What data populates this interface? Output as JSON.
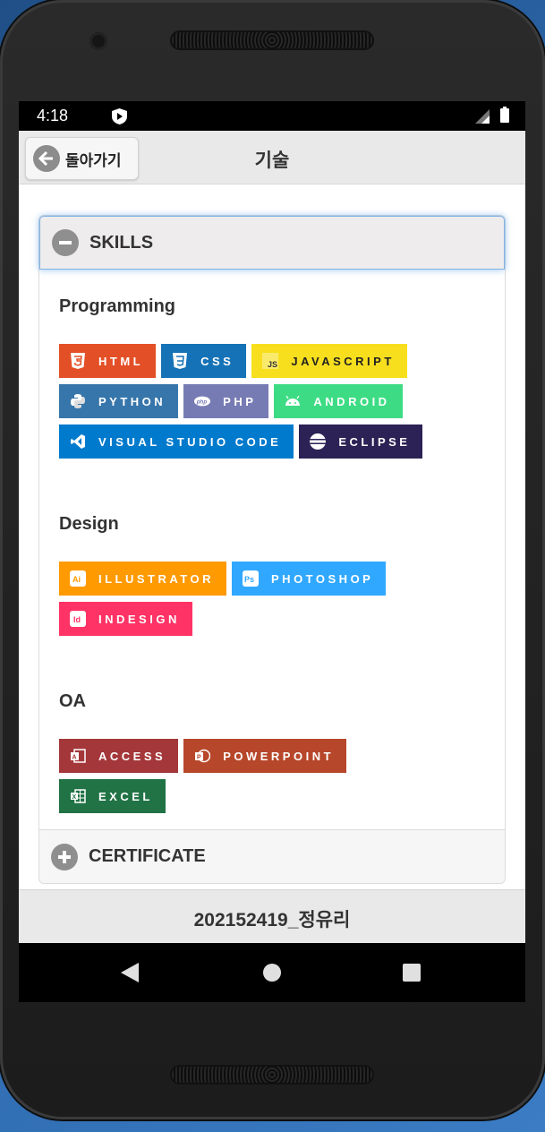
{
  "status": {
    "time": "4:18"
  },
  "topbar": {
    "back_label": "돌아가기",
    "title": "기술"
  },
  "skills": {
    "header": "SKILLS",
    "sections": [
      {
        "title": "Programming",
        "badges": [
          {
            "label": "HTML",
            "color": "#e34f26",
            "icon": "html5-icon"
          },
          {
            "label": "CSS",
            "color": "#1572b6",
            "icon": "css3-icon"
          },
          {
            "label": "JAVASCRIPT",
            "color": "#f7df1e",
            "icon": "javascript-icon"
          },
          {
            "label": "PYTHON",
            "color": "#3776ab",
            "icon": "python-icon"
          },
          {
            "label": "PHP",
            "color": "#777bb4",
            "icon": "php-icon"
          },
          {
            "label": "ANDROID",
            "color": "#3ddc84",
            "icon": "android-icon"
          },
          {
            "label": "VISUAL STUDIO CODE",
            "color": "#007acc",
            "icon": "vscode-icon"
          },
          {
            "label": "ECLIPSE",
            "color": "#2c2255",
            "icon": "eclipse-icon"
          }
        ]
      },
      {
        "title": "Design",
        "badges": [
          {
            "label": "ILLUSTRATOR",
            "color": "#ff9a00",
            "icon": "illustrator-icon"
          },
          {
            "label": "PHOTOSHOP",
            "color": "#31a8ff",
            "icon": "photoshop-icon"
          },
          {
            "label": "INDESIGN",
            "color": "#ff3366",
            "icon": "indesign-icon"
          }
        ]
      },
      {
        "title": "OA",
        "badges": [
          {
            "label": "ACCESS",
            "color": "#a4373a",
            "icon": "access-icon"
          },
          {
            "label": "POWERPOINT",
            "color": "#b7472a",
            "icon": "powerpoint-icon"
          },
          {
            "label": "EXCEL",
            "color": "#217346",
            "icon": "excel-icon"
          }
        ]
      }
    ]
  },
  "certificate": {
    "header": "CERTIFICATE"
  },
  "footer": {
    "text": "202152419_정유리"
  }
}
